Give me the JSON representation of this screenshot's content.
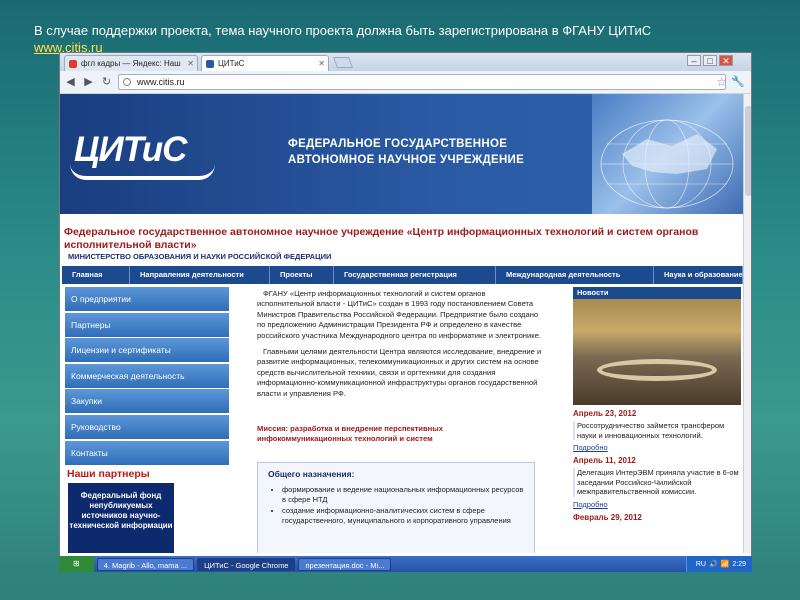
{
  "slide": {
    "title": "В случае поддержки проекта, тема научного проекта должна быть зарегистрирована в ФГАНУ ЦИТиС",
    "link": "www.citis.ru"
  },
  "browser": {
    "tabs": [
      {
        "label": "фгл кадры — Яндекс: Наш",
        "active": false
      },
      {
        "label": "ЦИТиС",
        "active": true
      }
    ],
    "url": "www.citis.ru",
    "icons": [
      "back-icon",
      "forward-icon",
      "reload-icon",
      "star-icon",
      "wrench-icon"
    ]
  },
  "site": {
    "logo": "ЦИТиС",
    "org_line1": "ФЕДЕРАЛЬНОЕ ГОСУДАРСТВЕННОЕ",
    "org_line2": "АВТОНОМНОЕ НАУЧНОЕ УЧРЕЖДЕНИЕ",
    "heading": "Федеральное государственное автономное научное учреждение «Центр информационных технологий и систем органов исполнительной власти»",
    "ministry": "МИНИСТЕРСТВО ОБРАЗОВАНИЯ И НАУКИ РОССИЙСКОЙ ФЕДЕРАЦИИ",
    "menu": [
      "Главная",
      "Направления деятельности",
      "Проекты",
      "Государственная регистрация",
      "Международная деятельность",
      "Наука и образование"
    ],
    "sidenav": [
      "О предприятии",
      "Партнеры",
      "Лицензии и сертификаты",
      "Коммерческая деятельность",
      "Закупки",
      "Руководство",
      "Контакты"
    ],
    "partners_title": "Наши партнеры",
    "partner_box": "Федеральный фонд непубликуемых источников научно-технической информации",
    "intro_p1": "ФГАНУ «Центр информационных технологий и систем органов исполнительной власти - ЦИТиС» создан в 1993 году постановлением Совета Министров Правительства Российской Федерации. Предприятие было создано по предложению Администрации Президента РФ и определено в качестве российского участника Международного центра по информатике и электронике.",
    "intro_p2": "Главными целями деятельности Центра являются исследование, внедрение и развитие информационных, телекоммуникационных и других систем на основе средств вычислительной техники, связи и оргтехники для создания информационно-коммуникационной инфраструктуры органов государственной власти и управления РФ.",
    "mission": "Миссия: разработка и внедрение перспективных инфокоммуникационных технологий и систем",
    "purpose_title": "Общего назначения:",
    "purpose_items": [
      "формирование и ведение национальных информационных ресурсов в сфере НТД",
      "создание информационно-аналитических систем в сфере государственного, муниципального и корпоративного управления"
    ],
    "news": {
      "title": "Новости",
      "items": [
        {
          "date": "Апрель 23, 2012",
          "text": "Россотрудничество займется трансфером науки и инновационных технологий.",
          "more": "Подробно"
        },
        {
          "date": "Апрель 11, 2012",
          "text": "Делегация ИнтерЭВМ приняла участие в 6-ом заседании Российско-Чилийской межправительственной комиссии.",
          "more": "Подробно"
        },
        {
          "date": "Февраль 29, 2012",
          "text": "",
          "more": ""
        }
      ]
    }
  },
  "taskbar": {
    "items": [
      {
        "label": "4. Magrib - Allo, mama ...",
        "active": false
      },
      {
        "label": "ЦИТиС - Google Chrome",
        "active": true
      },
      {
        "label": "презентация.doc - Mi...",
        "active": false
      }
    ],
    "lang": "RU",
    "clock": "2:29"
  }
}
